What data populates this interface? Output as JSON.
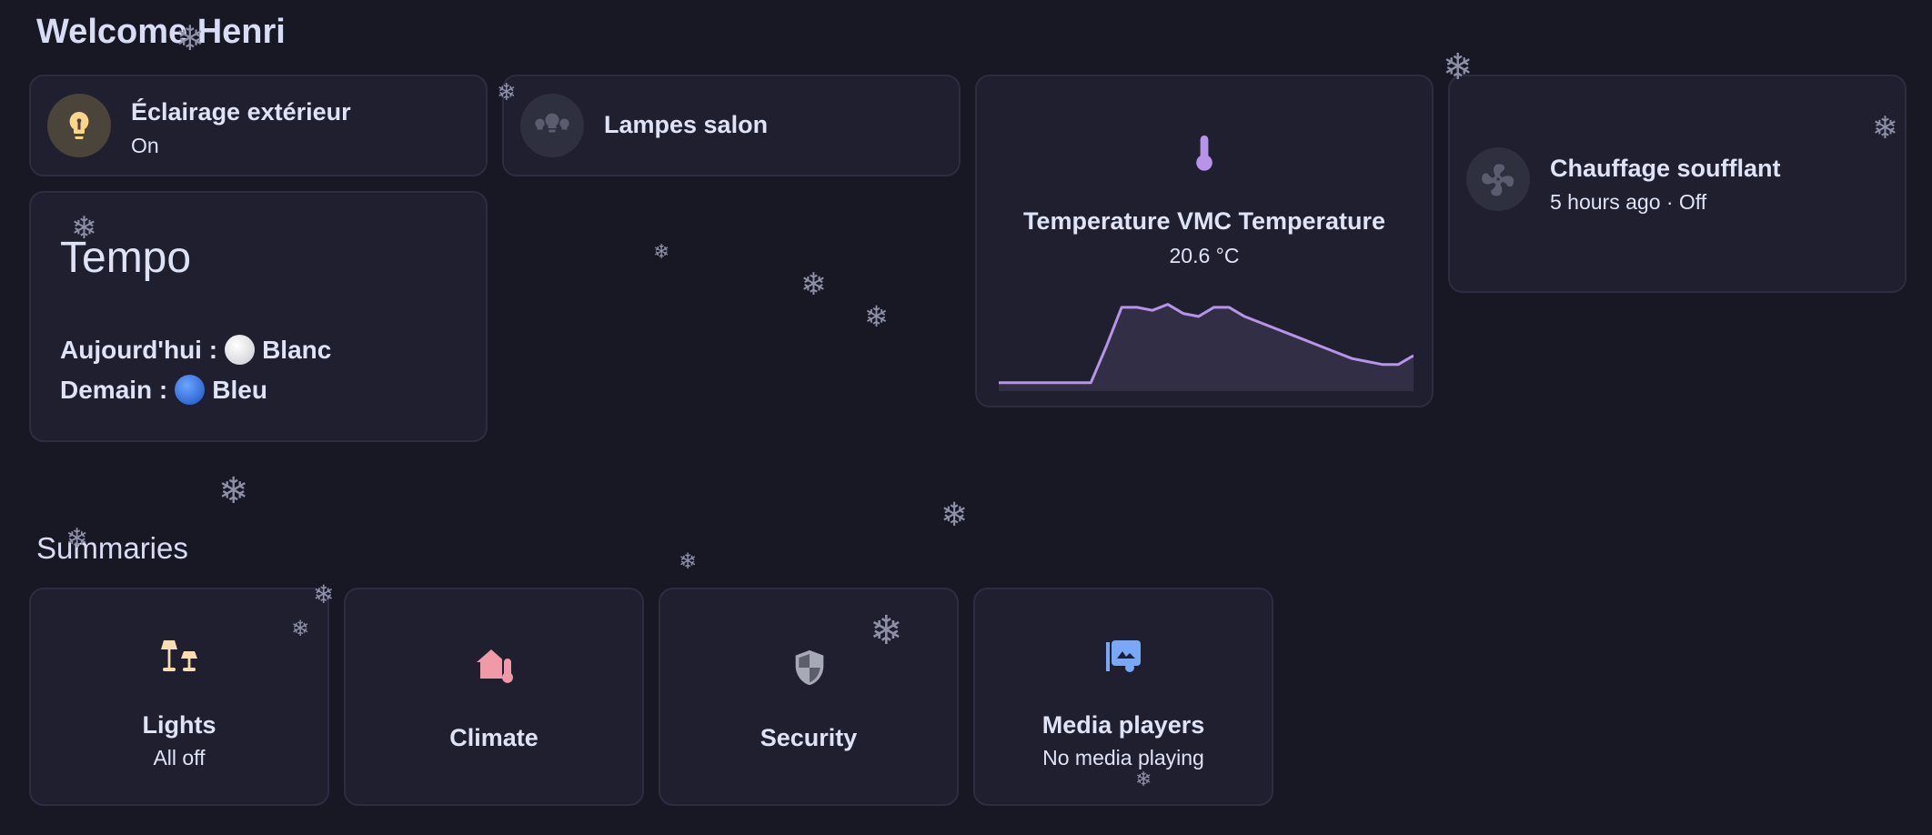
{
  "page": {
    "welcome": "Welcome Henri"
  },
  "tiles": {
    "eclairage": {
      "name": "Éclairage extérieur",
      "state": "On"
    },
    "lampes": {
      "name": "Lampes salon"
    },
    "chauffage": {
      "name": "Chauffage soufflant",
      "state": "5 hours ago · Off"
    }
  },
  "tempo": {
    "title": "Tempo",
    "today_label": "Aujourd'hui :",
    "today_value": "Blanc",
    "tomorrow_label": "Demain :",
    "tomorrow_value": "Bleu"
  },
  "sensor": {
    "name": "Temperature VMC Temperature",
    "value": "20.6 °C",
    "history": [
      19.4,
      19.4,
      19.4,
      19.4,
      19.4,
      19.4,
      19.4,
      20.6,
      21.9,
      21.9,
      21.8,
      22.0,
      21.7,
      21.6,
      21.9,
      21.9,
      21.6,
      21.4,
      21.2,
      21.0,
      20.8,
      20.6,
      20.4,
      20.2,
      20.1,
      20.0,
      20.0,
      20.3
    ]
  },
  "summaries": {
    "heading": "Summaries",
    "items": [
      {
        "name": "Lights",
        "state": "All off",
        "icon": "lamps-icon",
        "color": "#f7ddb0"
      },
      {
        "name": "Climate",
        "state": "",
        "icon": "home-thermometer-icon",
        "color": "#ef9aa6"
      },
      {
        "name": "Security",
        "state": "",
        "icon": "shield-icon",
        "color": "#a8a9b6"
      },
      {
        "name": "Media players",
        "state": "No media playing",
        "icon": "media-library-icon",
        "color": "#79a8f6"
      }
    ]
  },
  "colors": {
    "background": "#181825",
    "card": "#1f1f30",
    "accent_purple": "#b794ea",
    "bulb_on": "#fbd68a",
    "tempo_blue": "#2f6fe0"
  }
}
